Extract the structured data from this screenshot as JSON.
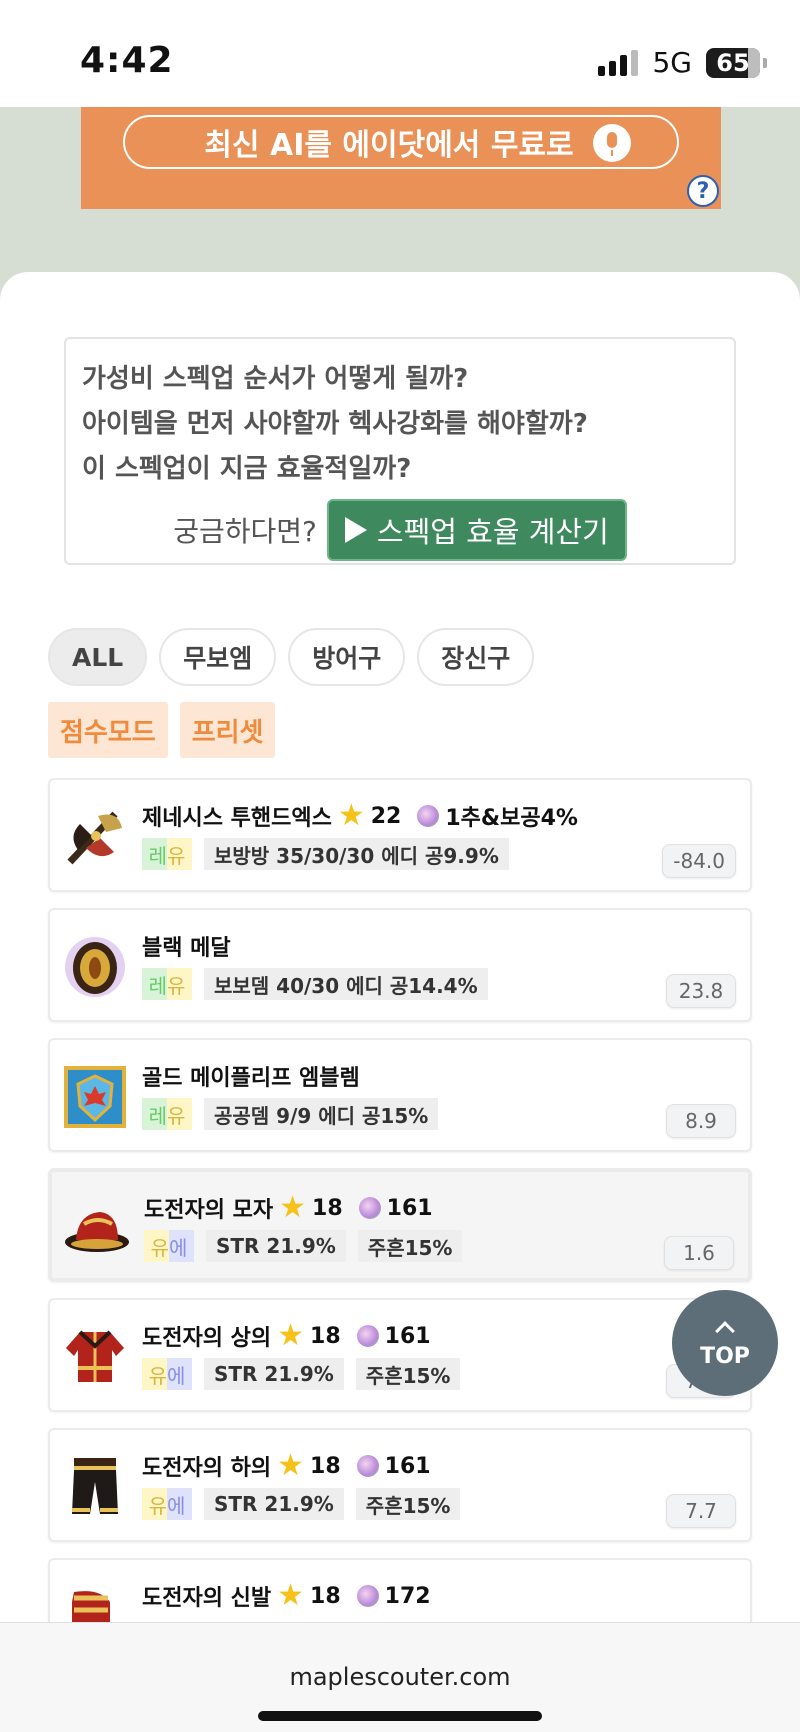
{
  "status_bar": {
    "time": "4:42",
    "network": "5G",
    "battery": "65"
  },
  "ad": {
    "text": "최신 AI를 에이닷에서 무료로",
    "help": "?"
  },
  "promo": {
    "lines": [
      "가성비 스펙업 순서가 어떻게 될까?",
      "아이템을 먼저 사야할까 헥사강화를 해야할까?",
      "이 스펙업이 지금 효율적일까?"
    ],
    "question": "궁금하다면?",
    "button_label": "스펙업 효율 계산기"
  },
  "filters": [
    {
      "label": "ALL",
      "active": true
    },
    {
      "label": "무보엠",
      "active": false
    },
    {
      "label": "방어구",
      "active": false
    },
    {
      "label": "장신구",
      "active": false
    }
  ],
  "modes": [
    "점수모드",
    "프리셋"
  ],
  "items": [
    {
      "name": "제네시스 투핸드엑스",
      "stars": "22",
      "gem": "1추&보공4%",
      "grade": [
        "레",
        "유"
      ],
      "option1": "보방방 35/30/30 에디 공9.9%",
      "option2": "",
      "score": "-84.0"
    },
    {
      "name": "블랙 메달",
      "stars": "",
      "gem": "",
      "grade": [
        "레",
        "유"
      ],
      "option1": "보보뎀 40/30 에디 공14.4%",
      "option2": "",
      "score": "23.8"
    },
    {
      "name": "골드 메이플리프 엠블렘",
      "stars": "",
      "gem": "",
      "grade": [
        "레",
        "유"
      ],
      "option1": "공공뎀 9/9 에디 공15%",
      "option2": "",
      "score": "8.9"
    },
    {
      "name": "도전자의 모자",
      "stars": "18",
      "gem": "161",
      "grade": [
        "유",
        "에"
      ],
      "option1": "STR 21.9%",
      "option2": "주흔15%",
      "score": "1.6"
    },
    {
      "name": "도전자의 상의",
      "stars": "18",
      "gem": "161",
      "grade": [
        "유",
        "에"
      ],
      "option1": "STR 21.9%",
      "option2": "주흔15%",
      "score": "7.7"
    },
    {
      "name": "도전자의 하의",
      "stars": "18",
      "gem": "161",
      "grade": [
        "유",
        "에"
      ],
      "option1": "STR 21.9%",
      "option2": "주흔15%",
      "score": "7.7"
    },
    {
      "name": "도전자의 신발",
      "stars": "18",
      "gem": "172",
      "grade": [
        "유",
        "에"
      ],
      "option1": "",
      "option2": "",
      "score": ""
    }
  ],
  "top_button": "TOP",
  "url": "maplescouter.com",
  "colors": {
    "accent_green": "#3e8a5e",
    "mode_orange": "#f08a3c",
    "ad_orange": "#e99157"
  }
}
